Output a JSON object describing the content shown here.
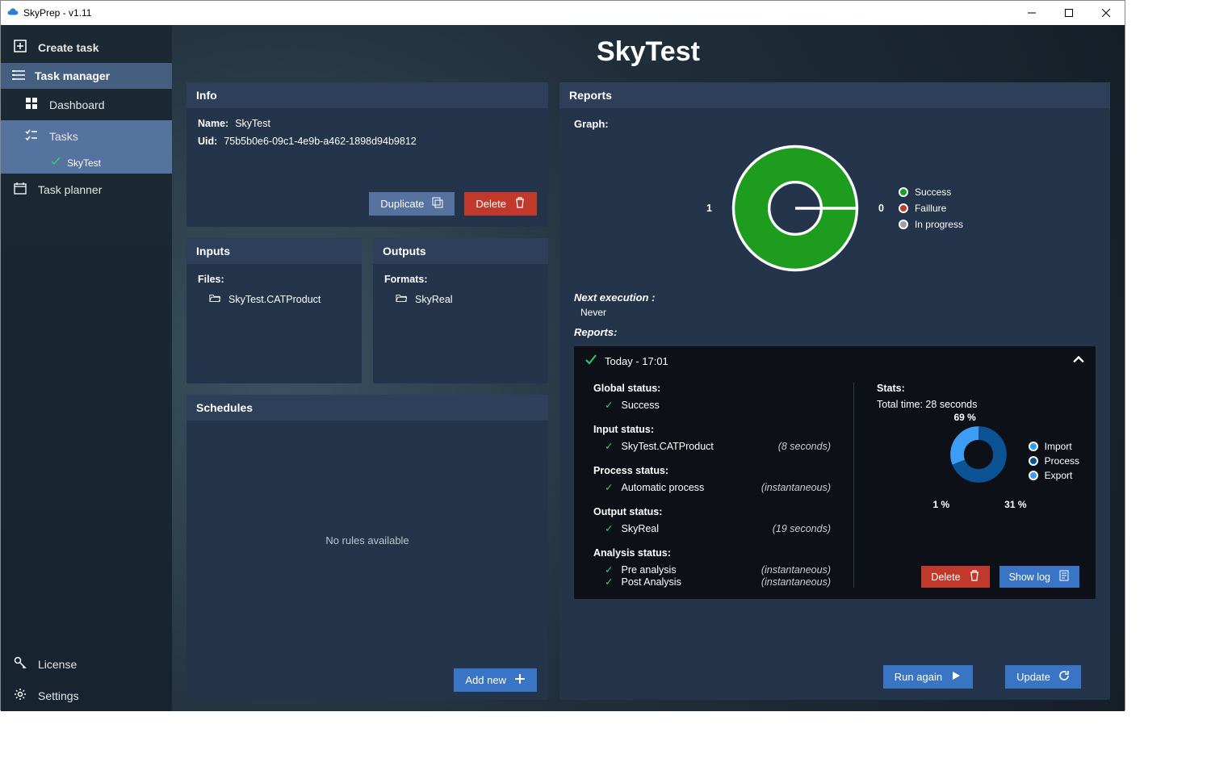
{
  "window": {
    "title": "SkyPrep - v1.11"
  },
  "sidebar": {
    "create_task": "Create task",
    "task_manager": "Task manager",
    "dashboard": "Dashboard",
    "tasks": "Tasks",
    "task_leaf": "SkyTest",
    "task_planner": "Task planner",
    "license": "License",
    "settings": "Settings"
  },
  "page": {
    "title": "SkyTest"
  },
  "info": {
    "header": "Info",
    "name_label": "Name:",
    "name_value": "SkyTest",
    "uid_label": "Uid:",
    "uid_value": "75b5b0e6-09c1-4e9b-a462-1898d94b9812",
    "duplicate": "Duplicate",
    "delete": "Delete"
  },
  "inputs": {
    "header": "Inputs",
    "files_label": "Files:",
    "file": "SkyTest.CATProduct"
  },
  "outputs": {
    "header": "Outputs",
    "formats_label": "Formats:",
    "format": "SkyReal"
  },
  "schedules": {
    "header": "Schedules",
    "empty": "No rules available",
    "add_new": "Add new"
  },
  "reports": {
    "header": "Reports",
    "graph_label": "Graph:",
    "left_val": "1",
    "right_val": "0",
    "legend": {
      "success": "Success",
      "failure": "Faillure",
      "inprogress": "In progress"
    },
    "next_exec_label": "Next execution :",
    "next_exec_value": "Never",
    "reports_label": "Reports:",
    "item": {
      "time": "Today  -  17:01",
      "global_status_h": "Global status:",
      "global_status_v": "Success",
      "input_status_h": "Input status:",
      "input_status_v": "SkyTest.CATProduct",
      "input_status_d": "(8 seconds)",
      "process_status_h": "Process status:",
      "process_status_v": "Automatic process",
      "process_status_d": "(instantaneous)",
      "output_status_h": "Output status:",
      "output_status_v": "SkyReal",
      "output_status_d": "(19 seconds)",
      "analysis_status_h": "Analysis status:",
      "analysis_pre": "Pre analysis",
      "analysis_pre_d": "(instantaneous)",
      "analysis_post": "Post Analysis",
      "analysis_post_d": "(instantaneous)",
      "stats_h": "Stats:",
      "total_time": "Total time: 28 seconds",
      "pct_import": "69 %",
      "pct_process": "1 %",
      "pct_export": "31 %",
      "leg_import": "Import",
      "leg_process": "Process",
      "leg_export": "Export",
      "delete": "Delete",
      "show_log": "Show log"
    },
    "run_again": "Run again",
    "update": "Update"
  },
  "colors": {
    "success": "#1e9c1e",
    "failure": "#c0392b",
    "inprogress": "#9aa0a6",
    "import": "#0b5394",
    "process": "#1c4587",
    "export": "#3d9df5"
  },
  "chart_data": [
    {
      "type": "pie",
      "title": "Reports graph",
      "categories": [
        "Success",
        "Faillure",
        "In progress"
      ],
      "values": [
        1,
        0,
        0
      ],
      "colors": [
        "#1e9c1e",
        "#c0392b",
        "#9aa0a6"
      ],
      "labels_left": "1",
      "labels_right": "0"
    },
    {
      "type": "pie",
      "title": "Stats",
      "categories": [
        "Import",
        "Process",
        "Export"
      ],
      "values": [
        69,
        1,
        31
      ],
      "unit": "%",
      "colors": [
        "#0b5394",
        "#1c4587",
        "#3d9df5"
      ]
    }
  ]
}
